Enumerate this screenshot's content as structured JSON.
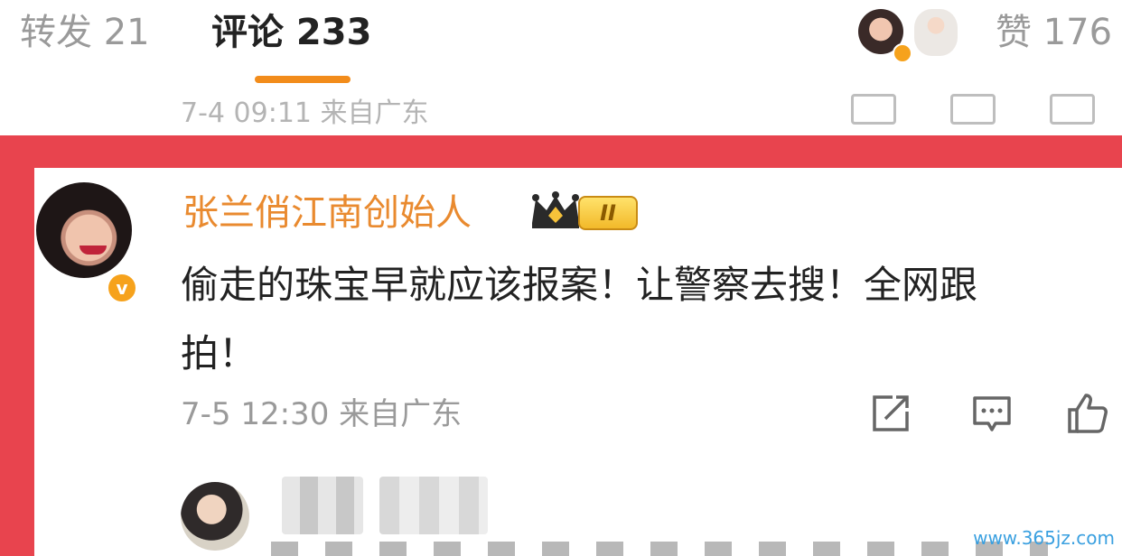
{
  "tabs": {
    "repost": "转发 21",
    "comments": "评论 233",
    "likes": "赞 176"
  },
  "previous_post": {
    "time_location": "7-4 09:11 来自广东"
  },
  "comment": {
    "author": "张兰俏江南创始人",
    "level": "II",
    "verify_mark": "v",
    "text_line1": "偷走的珠宝早就应该报案！让警察去搜！全网跟",
    "text_line2": "拍！",
    "time_location": "7-5 12:30 来自广东"
  },
  "icons": {
    "share": "share-icon",
    "comment": "comment-icon",
    "like": "thumbs-up-icon",
    "crown": "crown-icon"
  },
  "colors": {
    "accent_orange": "#f28c1b",
    "username": "#e98a2f",
    "highlight_frame": "#e8444e"
  },
  "watermark": "www.365jz.com"
}
